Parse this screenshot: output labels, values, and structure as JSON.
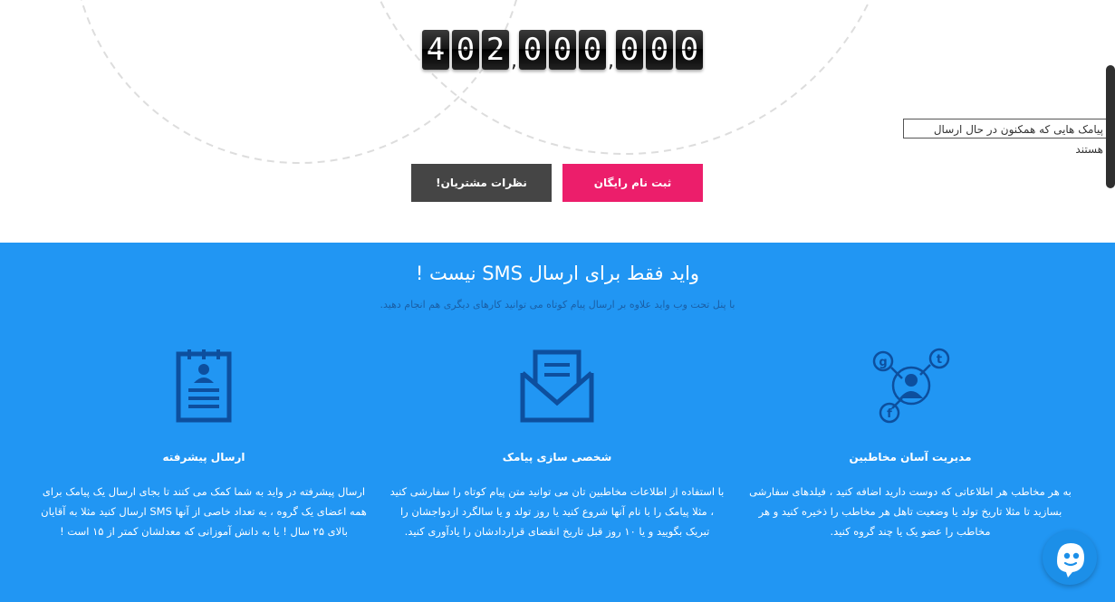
{
  "counter": {
    "groups": [
      "402",
      "000",
      "000"
    ],
    "separator": ","
  },
  "tooltip": "پیامک هایی که همکنون در حال ارسال هستند",
  "buttons": {
    "signup": "ثبت نام رایگان",
    "reviews": "نظرات مشتریان!"
  },
  "section": {
    "heading": "واید فقط برای ارسال SMS نیست !",
    "subheading": "با پنل تحت وب واید علاوه بر ارسال پیام کوتاه می توانید کارهای دیگری هم انجام دهید."
  },
  "features": [
    {
      "icon": "contact-network-icon",
      "title": "مدیریت آسان مخاطبین",
      "desc": "به هر مخاطب هر اطلاعاتی که دوست دارید اضافه کنید ، فیلدهای سفارشی بسازید تا مثلا تاریخ تولد یا وضعیت تاهل هر مخاطب را ذخیره کنید و هر مخاطب را عضو یک یا چند گروه کنید."
    },
    {
      "icon": "envelope-icon",
      "title": "شخصی سازی پیامک",
      "desc": "با استفاده از اطلاعات مخاطبین تان می توانید متن پیام کوتاه را سفارشی کنید ، مثلا پیامک را با نام آنها شروع کنید یا روز تولد و یا سالگرد ازدواجشان را تبریک بگویید و یا ۱۰ روز قبل تاریخ انقضای قراردادشان را یادآوری کنید."
    },
    {
      "icon": "profile-clipboard-icon",
      "title": "ارسال پیشرفته",
      "desc": "ارسال پیشرفته در واید به شما کمک می کنند تا بجای ارسال یک پیامک برای همه اعضای یک گروه ، به تعداد خاصی از آنها SMS ارسال کنید مثلا به آقایان بالای ۲۵ سال ! یا به دانش آموزانی که معدلشان کمتر از ۱۵ است !"
    }
  ],
  "colors": {
    "accent_pink": "#ec1e6b",
    "dark_button": "#454545",
    "section_blue": "#2196f3",
    "icon_dark_blue": "#0d4f9e"
  }
}
